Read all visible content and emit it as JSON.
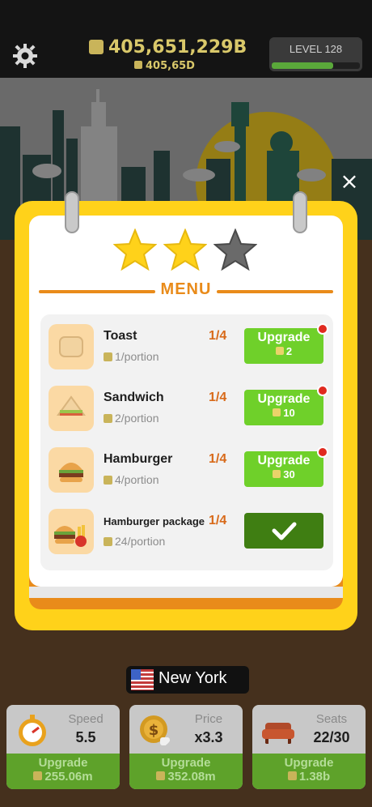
{
  "top": {
    "money": "405,651,229B",
    "money_sub": "405,65D",
    "level": "LEVEL 128",
    "level_progress": 0.7
  },
  "modal": {
    "menu_title": "MENU",
    "stars_filled": 2,
    "stars_total": 3,
    "items": [
      {
        "name": "Toast",
        "portion": "1/portion",
        "count": "1/4",
        "upgrade_label": "Upgrade",
        "cost": "2",
        "notify": true
      },
      {
        "name": "Sandwich",
        "portion": "2/portion",
        "count": "1/4",
        "upgrade_label": "Upgrade",
        "cost": "10",
        "notify": true
      },
      {
        "name": "Hamburger",
        "portion": "4/portion",
        "count": "1/4",
        "upgrade_label": "Upgrade",
        "cost": "30",
        "notify": true
      },
      {
        "name": "Hamburger package",
        "portion": "24/portion",
        "count": "1/4",
        "completed": true
      }
    ]
  },
  "city": {
    "name": "New York"
  },
  "stats": [
    {
      "label": "Speed",
      "value": "5.5",
      "upgrade_label": "Upgrade",
      "cost": "255.06m",
      "icon": "stopwatch-icon"
    },
    {
      "label": "Price",
      "value": "x3.3",
      "upgrade_label": "Upgrade",
      "cost": "352.08m",
      "icon": "coin-icon"
    },
    {
      "label": "Seats",
      "value": "22/30",
      "upgrade_label": "Upgrade",
      "cost": "1.38b",
      "icon": "sofa-icon"
    }
  ],
  "colors": {
    "accent": "#ffd21a",
    "orange": "#e98b1a",
    "green": "#6fd02a",
    "dark_green": "#3f7e12"
  }
}
